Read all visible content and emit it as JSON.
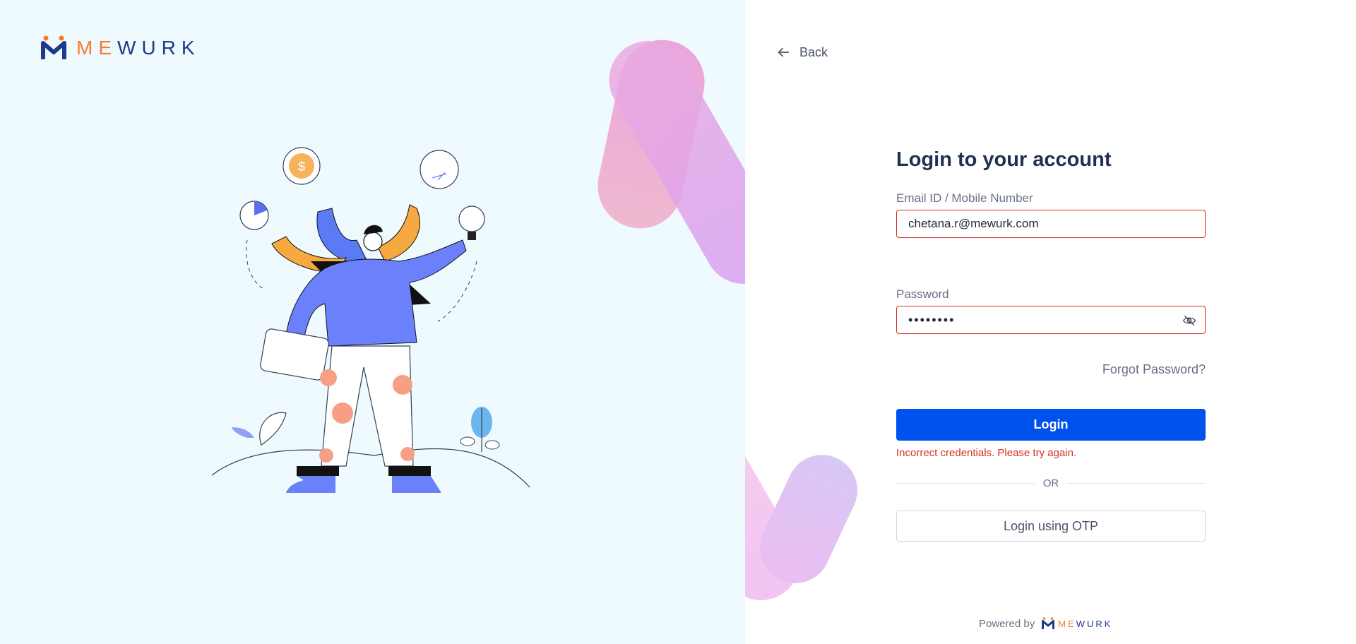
{
  "brand": {
    "logo_me": "ME",
    "logo_wurk": "WURK",
    "colors": {
      "orange": "#f47b2a",
      "navy": "#1e3a8a",
      "primary": "#0052ee",
      "error": "#d92d20"
    }
  },
  "nav": {
    "back_label": "Back"
  },
  "form": {
    "title": "Login to your account",
    "email_label": "Email ID / Mobile Number",
    "email_value": "chetana.r@mewurk.com",
    "password_label": "Password",
    "password_value": "••••••••",
    "forgot_label": "Forgot Password?",
    "login_label": "Login",
    "error_text": "Incorrect credentials. Please try again.",
    "or_text": "OR",
    "otp_label": "Login using OTP"
  },
  "footer": {
    "powered_by": "Powered by"
  },
  "icons": [
    "mewurk-logo-icon",
    "arrow-left-icon",
    "eye-off-icon"
  ]
}
